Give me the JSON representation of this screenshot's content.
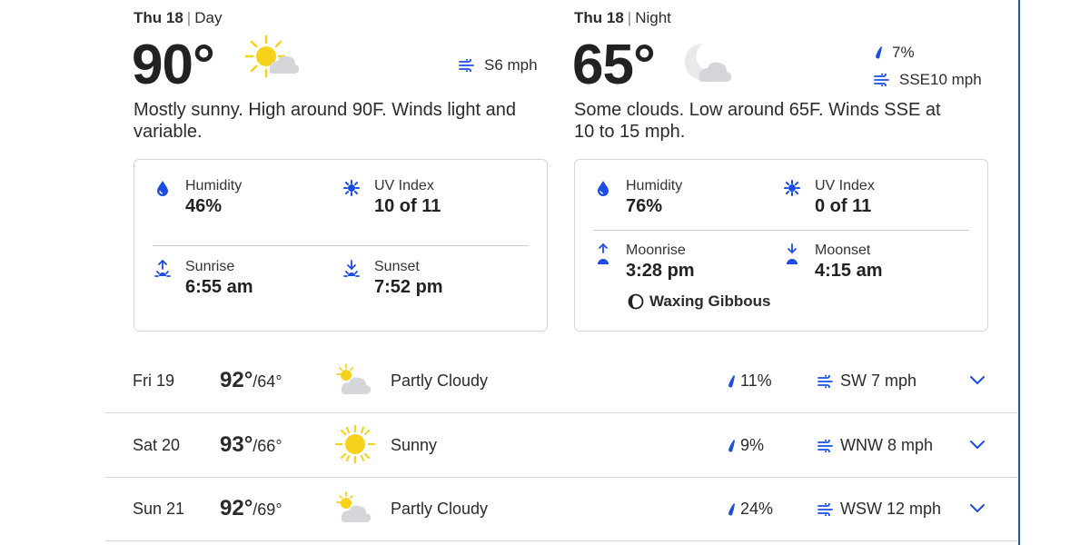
{
  "day": {
    "date": "Thu 18",
    "period": "Day",
    "temp": "90°",
    "icon": "mostly-sunny-icon",
    "wind": "S6 mph",
    "description": "Mostly sunny. High around 90F. Winds light and variable.",
    "stats": {
      "humidity_label": "Humidity",
      "humidity_value": "46%",
      "uv_label": "UV Index",
      "uv_value": "10 of 11",
      "sunrise_label": "Sunrise",
      "sunrise_value": "6:55 am",
      "sunset_label": "Sunset",
      "sunset_value": "7:52 pm"
    }
  },
  "night": {
    "date": "Thu 18",
    "period": "Night",
    "temp": "65°",
    "icon": "partly-cloudy-night-icon",
    "precip": "7%",
    "wind": "SSE10 mph",
    "description": "Some clouds. Low around 65F. Winds SSE at 10 to 15 mph.",
    "stats": {
      "humidity_label": "Humidity",
      "humidity_value": "76%",
      "uv_label": "UV Index",
      "uv_value": "0 of 11",
      "moonrise_label": "Moonrise",
      "moonrise_value": "3:28 pm",
      "moonset_label": "Moonset",
      "moonset_value": "4:15 am",
      "moon_phase": "Waxing Gibbous"
    }
  },
  "forecast": [
    {
      "day": "Fri 19",
      "high": "92°",
      "low": "/64°",
      "icon": "partly-cloudy-icon",
      "condition": "Partly Cloudy",
      "precip": "11%",
      "wind": "SW 7 mph"
    },
    {
      "day": "Sat 20",
      "high": "93°",
      "low": "/66°",
      "icon": "sunny-icon",
      "condition": "Sunny",
      "precip": "9%",
      "wind": "WNW 8 mph"
    },
    {
      "day": "Sun 21",
      "high": "92°",
      "low": "/69°",
      "icon": "partly-cloudy-icon",
      "condition": "Partly Cloudy",
      "precip": "24%",
      "wind": "WSW 12 mph"
    }
  ],
  "colors": {
    "accent": "#1b4de4",
    "sun": "#f7d21b",
    "cloud": "#d4d6d9"
  }
}
